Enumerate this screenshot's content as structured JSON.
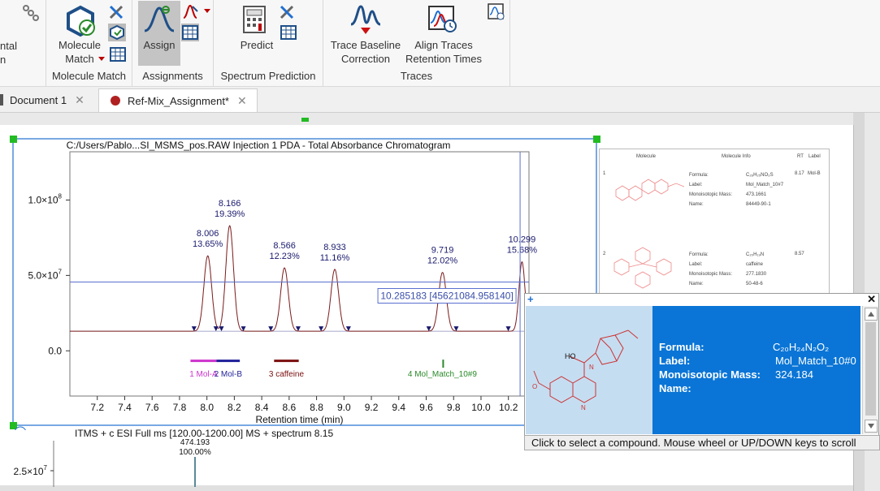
{
  "ribbon": {
    "cut_label_lines": [
      "ntal",
      "n"
    ],
    "groups": [
      {
        "label": "Molecule Match",
        "buttons": [
          {
            "label_lines": [
              "Molecule",
              "Match"
            ]
          }
        ]
      },
      {
        "label": "Assignments",
        "buttons": [
          {
            "label_lines": [
              "Assign"
            ]
          }
        ]
      },
      {
        "label": "Spectrum Prediction",
        "buttons": [
          {
            "label_lines": [
              "Predict"
            ]
          }
        ]
      },
      {
        "label": "Traces",
        "buttons": [
          {
            "label_lines": [
              "Trace Baseline",
              "Correction"
            ]
          },
          {
            "label_lines": [
              "Align Traces",
              "Retention Times"
            ]
          }
        ]
      }
    ]
  },
  "tabs": [
    {
      "label": "Document 1",
      "active": false
    },
    {
      "label": "Ref-Mix_Assignment*",
      "active": true
    }
  ],
  "chromatogram": {
    "title": "C:/Users/Pablo...SI_MSMS_pos.RAW Injection 1  PDA - Total Absorbance Chromatogram",
    "xlabel": "Retention time (min)",
    "cursor_readout": "10.285183 [45621084.958140]"
  },
  "chart_data": {
    "type": "line",
    "xlabel": "Retention time (min)",
    "xlim": [
      7.0,
      10.35
    ],
    "ylim": [
      -30000000.0,
      132000000.0
    ],
    "x_ticks": [
      "7.2",
      "7.4",
      "7.6",
      "7.8",
      "8.0",
      "8.2",
      "8.4",
      "8.6",
      "8.8",
      "9.0",
      "9.2",
      "9.4",
      "9.6",
      "9.8",
      "10.0",
      "10.2"
    ],
    "y_ticks": [
      {
        "value": 0,
        "base": "0.0",
        "exp": ""
      },
      {
        "value": 50000000.0,
        "base": "5.0×10",
        "exp": "7"
      },
      {
        "value": 100000000.0,
        "base": "1.0×10",
        "exp": "8"
      }
    ],
    "baseline": 13000000.0,
    "peaks": [
      {
        "rt": 8.006,
        "label_rt": "8.006",
        "area": "13.65%",
        "height": 63000000.0,
        "width": 0.028
      },
      {
        "rt": 8.166,
        "label_rt": "8.166",
        "area": "19.39%",
        "height": 83000000.0,
        "width": 0.028
      },
      {
        "rt": 8.566,
        "label_rt": "8.566",
        "area": "12.23%",
        "height": 55000000.0,
        "width": 0.028
      },
      {
        "rt": 8.933,
        "label_rt": "8.933",
        "area": "11.16%",
        "height": 54000000.0,
        "width": 0.028
      },
      {
        "rt": 9.719,
        "label_rt": "9.719",
        "area": "12.02%",
        "height": 52000000.0,
        "width": 0.028
      },
      {
        "rt": 10.299,
        "label_rt": "10.299",
        "area": "15.68%",
        "height": 59000000.0,
        "width": 0.022
      }
    ],
    "assignments": [
      {
        "label": "1 Mol-A",
        "color": "#cc33cc",
        "x_from": 7.88,
        "x_to": 8.07
      },
      {
        "label": "2 Mol-B",
        "color": "#1f1f99",
        "x_from": 8.07,
        "x_to": 8.24
      },
      {
        "label": "3 caffeine",
        "color": "#7a0f0f",
        "x_from": 8.49,
        "x_to": 8.67
      },
      {
        "label": "4 Mol_Match_10#9",
        "color": "#2a8a2a",
        "x_from": 9.718,
        "x_to": 9.72
      }
    ],
    "cursor": {
      "x": 10.285183,
      "y": 45621084.95814
    }
  },
  "spectrum": {
    "title": "ITMS + c ESI Full ms [120.00-1200.00] MS + spectrum 8.15",
    "peak_mz": "474.193",
    "peak_pct": "100.00%",
    "y_tick_base": "2.5×10",
    "y_tick_exp": "7"
  },
  "molecule_table": {
    "headers": [
      "Molecule",
      "Molecule Info",
      "RT",
      "Label"
    ],
    "rows": [
      {
        "index": "1",
        "formula_label": "Formula:",
        "formula": "C₂₆H₂₅NO₃S",
        "label_label": "Label:",
        "label": "Mol_Match_10#7",
        "mass_label": "Monoisotopic Mass:",
        "mass": "473.1661",
        "name_label": "Name:",
        "name": "84449-90-1",
        "rt": "8.17",
        "tag": "Mol-B"
      },
      {
        "index": "2",
        "formula_label": "Formula:",
        "formula": "C₂₀H₁₉N",
        "label_label": "Label:",
        "label": "caffeine",
        "mass_label": "Monoisotopic Mass:",
        "mass": "277.1830",
        "name_label": "Name:",
        "name": "50-48-6",
        "rt": "8.57",
        "tag": ""
      }
    ]
  },
  "popup": {
    "formula_label": "Formula:",
    "formula": "C₂₀H₂₄N₂O₂",
    "label_label": "Label:",
    "label": "Mol_Match_10#0",
    "mass_label": "Monoisotopic Mass:",
    "mass": "324.184",
    "name_label": "Name:",
    "name": "",
    "hint": "Click to select a compound. Mouse wheel or UP/DOWN keys to scroll"
  },
  "colors": {
    "trace": "#7a1a1a",
    "cursor": "#5a6fcf",
    "selection_handle": "#22bb22",
    "peak_label": "#1a1a6e",
    "popup_bg": "#0a75d6"
  }
}
